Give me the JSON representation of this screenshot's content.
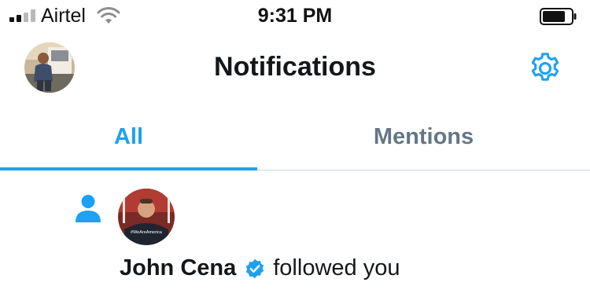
{
  "status_bar": {
    "carrier": "Airtel",
    "time": "9:31 PM",
    "signal_bars": 4,
    "signal_bars_filled": 2,
    "battery_level": 0.8
  },
  "header": {
    "title": "Notifications",
    "profile_avatar_icon": "avatar",
    "settings_icon": "gear-icon"
  },
  "tabs": [
    {
      "label": "All",
      "active": true
    },
    {
      "label": "Mentions",
      "active": false
    }
  ],
  "notifications": [
    {
      "type_icon": "person-icon",
      "user_name": "John Cena",
      "verified": true,
      "action": "followed you",
      "avatar_caption": "#WeAreAmerica"
    }
  ],
  "colors": {
    "accent": "#1da1f2",
    "text_primary": "#14171a",
    "text_secondary": "#657786",
    "divider": "#ccd6dd"
  }
}
